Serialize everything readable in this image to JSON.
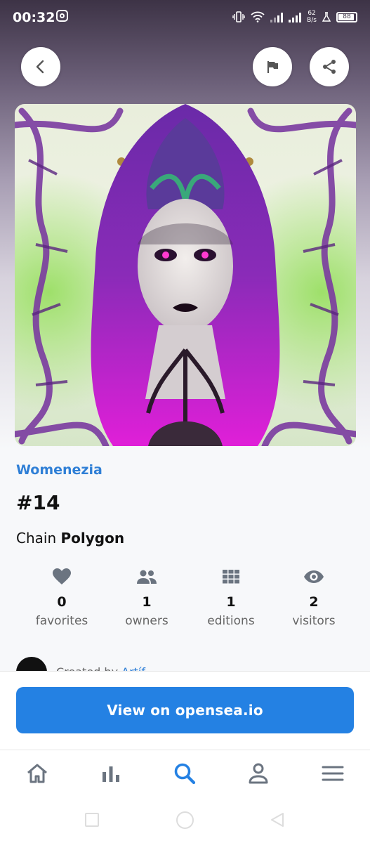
{
  "status_bar": {
    "time": "00:32",
    "net_speed_top": "62",
    "net_speed_bottom": "B/s",
    "battery": "88",
    "icons": [
      "instagram-icon",
      "vibrate-icon",
      "wifi-icon",
      "signal-icon",
      "signal-roaming-icon",
      "flask-icon",
      "battery-icon"
    ]
  },
  "header": {
    "back_icon": "chevron-left-icon",
    "report_icon": "flag-icon",
    "share_icon": "share-icon"
  },
  "nft": {
    "collection": "Womenezia",
    "token": "#14",
    "chain_label": "Chain",
    "chain_value": "Polygon"
  },
  "stats": [
    {
      "icon": "heart-icon",
      "value": "0",
      "label": "favorites"
    },
    {
      "icon": "people-icon",
      "value": "1",
      "label": "owners"
    },
    {
      "icon": "grid-icon",
      "value": "1",
      "label": "editions"
    },
    {
      "icon": "eye-icon",
      "value": "2",
      "label": "visitors"
    }
  ],
  "created_by": {
    "label": "Created by",
    "name": "Artíf..."
  },
  "cta": {
    "label": "View on opensea.io"
  },
  "bottom_nav": [
    {
      "icon": "home-icon",
      "active": false
    },
    {
      "icon": "bar-chart-icon",
      "active": false
    },
    {
      "icon": "search-icon",
      "active": true
    },
    {
      "icon": "person-icon",
      "active": false
    },
    {
      "icon": "menu-icon",
      "active": false
    }
  ],
  "colors": {
    "accent": "#2481e3",
    "link": "#2f7fd6",
    "icon_grey": "#6b7480"
  }
}
